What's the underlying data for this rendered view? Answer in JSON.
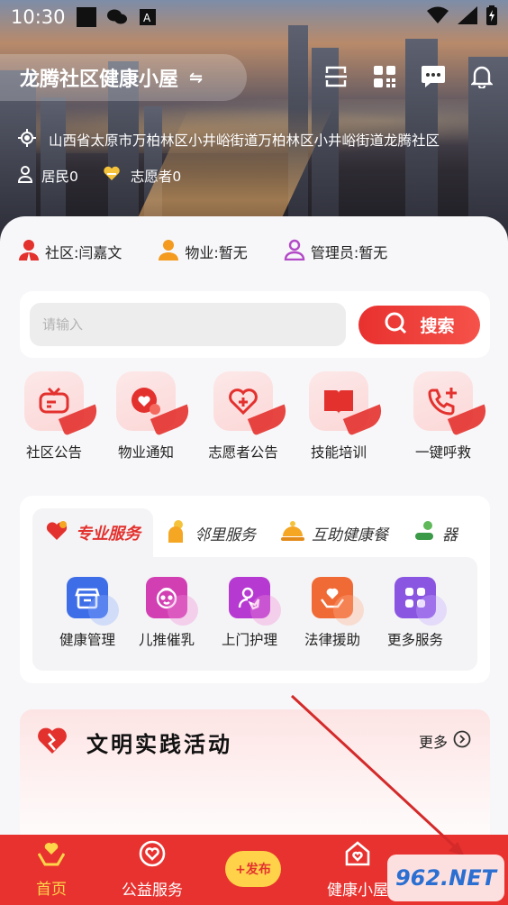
{
  "status_bar": {
    "time": "10:30"
  },
  "header": {
    "title": "龙腾社区健康小屋",
    "swap_glyph": "⇋",
    "address": "山西省太原市万柏林区小井峪街道万柏林区小井峪街道龙腾社区",
    "residents": "居民0",
    "volunteers": "志愿者0"
  },
  "roles": [
    {
      "label": "社区:闫嘉文",
      "icon": "community-person-icon",
      "color": "#e3312e"
    },
    {
      "label": "物业:暂无",
      "icon": "property-person-icon",
      "color": "#f39a1f"
    },
    {
      "label": "管理员:暂无",
      "icon": "admin-person-icon",
      "color": "#b34ac7"
    }
  ],
  "search": {
    "placeholder": "请输入",
    "button_label": "搜索"
  },
  "quick_actions": [
    {
      "label": "社区公告",
      "icon": "announcement-icon"
    },
    {
      "label": "物业通知",
      "icon": "notice-heart-icon"
    },
    {
      "label": "志愿者公告",
      "icon": "volunteer-heart-icon"
    },
    {
      "label": "技能培训",
      "icon": "book-icon"
    },
    {
      "label": "一键呼救",
      "icon": "phone-plus-icon"
    }
  ],
  "service_tabs": [
    {
      "label": "专业服务",
      "icon": "heart-hand-icon",
      "active": true
    },
    {
      "label": "邻里服务",
      "icon": "neighbor-icon",
      "active": false
    },
    {
      "label": "互助健康餐",
      "icon": "meal-icon",
      "active": false
    },
    {
      "label": "器",
      "icon": "equipment-icon",
      "active": false
    }
  ],
  "services": [
    {
      "label": "健康管理",
      "icon": "health-box-icon",
      "color": "#3d6ee8",
      "halo": "#8fb0ff"
    },
    {
      "label": "儿推催乳",
      "icon": "baby-icon",
      "color": "#d23fb3",
      "halo": "#f28ad9"
    },
    {
      "label": "上门护理",
      "icon": "nurse-icon",
      "color": "#b63ad1",
      "halo": "#f08ad8"
    },
    {
      "label": "法律援助",
      "icon": "law-hand-icon",
      "color": "#f06a36",
      "halo": "#ffb08a"
    },
    {
      "label": "更多服务",
      "icon": "grid-icon",
      "color": "#8a55e0",
      "halo": "#c7a8ff"
    }
  ],
  "activity": {
    "title": "文明实践活动",
    "more_label": "更多"
  },
  "bottom_nav": [
    {
      "label": "首页",
      "icon": "home-hands-icon",
      "active": true
    },
    {
      "label": "公益服务",
      "icon": "charity-heart-icon",
      "active": false
    },
    {
      "label": "健康小屋",
      "icon": "health-house-icon",
      "active": false
    }
  ],
  "publish_button": "+发布",
  "watermark": "962.NET"
}
